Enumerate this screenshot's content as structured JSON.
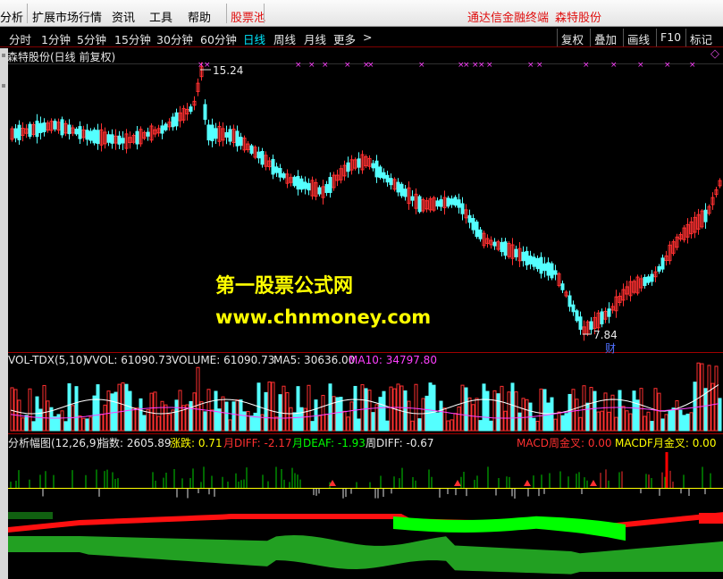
{
  "menu": {
    "items": [
      "分析",
      "扩展市场行情",
      "资讯",
      "工具",
      "帮助"
    ],
    "stock_pool": "股票池",
    "brand": "通达信金融终端",
    "stock_name": "森特股份"
  },
  "periods": [
    "分时",
    "1分钟",
    "5分钟",
    "15分钟",
    "30分钟",
    "60分钟",
    "日线",
    "周线",
    "月线",
    "更多"
  ],
  "active_period": "日线",
  "more_arrow": ">",
  "tools": [
    "复权",
    "叠加",
    "画线",
    "F10",
    "标记"
  ],
  "main_chart": {
    "title": "森特股份(日线 前复权)",
    "high_label": "15.24",
    "low_label": "7.84",
    "fin_mark": "财",
    "diamond": "◇"
  },
  "watermark": {
    "line1": "第一股票公式网",
    "line2": "www.chnmoney.com"
  },
  "vol_indicator": {
    "name": "VOL-TDX(5,10)",
    "vvol": "VVOL: 61090.73",
    "volume": "VOLUME: 61090.73",
    "ma5": "MA5: 30636.00",
    "ma10": "MA10: 34797.80"
  },
  "indicator3": {
    "name": "分析幅图(12,26,9)",
    "index": "指数: 2605.89",
    "change": "涨跌: 0.71",
    "mdiff": "月DIFF: -2.17",
    "mdeaf": "月DEAF: -1.93",
    "wdiff": "周DIFF: -0.67",
    "macd_w": "MACD周金叉: 0.00",
    "macd_m": "MACDF月金叉: 0.00"
  },
  "colors": {
    "up": "#ff3030",
    "down": "#54ffff",
    "panel_border": "#a00000",
    "ma5": "#ffffff",
    "ma10": "#ff40ff",
    "green_band": "#22a022",
    "bright_green": "#00ff00",
    "red_band": "#ff1010"
  }
}
